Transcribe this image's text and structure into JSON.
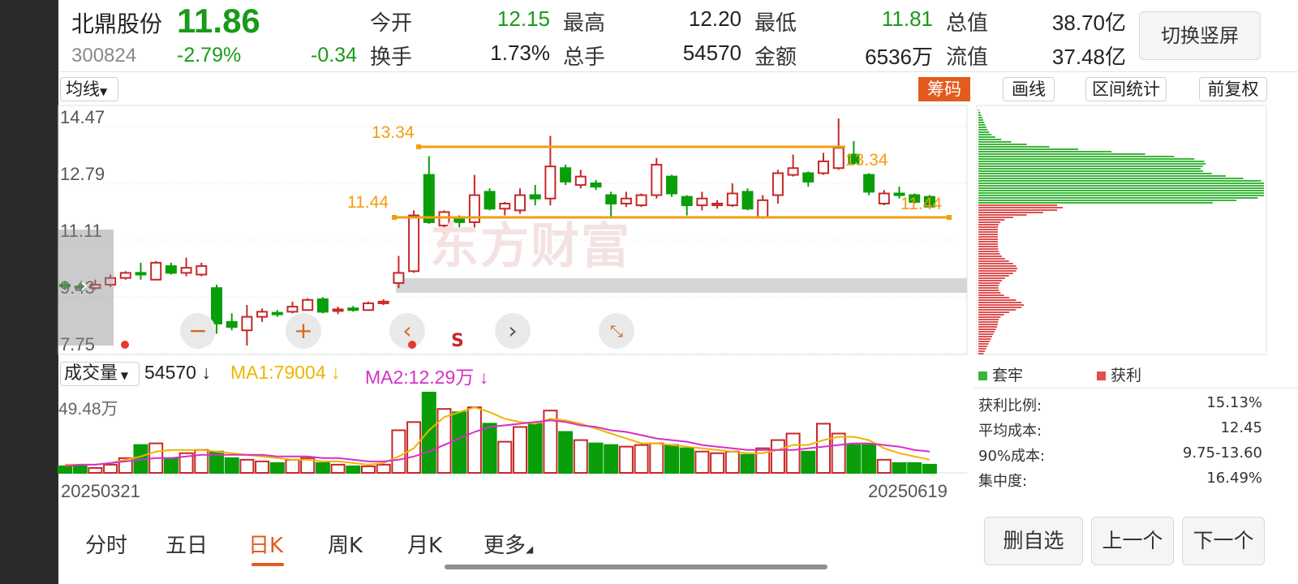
{
  "header": {
    "name": "北鼎股份",
    "price": "11.86",
    "code": "300824",
    "change_pct": "-2.79%",
    "change": "-0.34",
    "open_label": "今开",
    "open_value": "12.15",
    "high_label": "最高",
    "high_value": "12.20",
    "low_label": "最低",
    "low_value": "11.81",
    "mcap_label": "总值",
    "mcap_value": "38.70亿",
    "turnover_label": "换手",
    "turnover_value": "1.73%",
    "volume_label": "总手",
    "volume_value": "54570",
    "amount_label": "金额",
    "amount_value": "6536万",
    "float_label": "流值",
    "float_value": "37.48亿",
    "switch_button": "切换竖屏"
  },
  "toolbar": {
    "ma_select": "均线",
    "chips_button": "筹码",
    "draw_button": "画线",
    "range_stats_button": "区间统计",
    "adjust_button": "前复权"
  },
  "price_chart": {
    "y_ticks": [
      "14.47",
      "12.79",
      "11.11",
      "9.43",
      "7.75"
    ],
    "y_min": 7.75,
    "y_max": 14.47,
    "line_upper_label": "13.34",
    "line_upper_value": 13.34,
    "line_lower_label": "11.44",
    "line_lower_value": 11.44,
    "upper_right_label": "13.34",
    "lower_right_label": "11.44",
    "sell_marker": "S",
    "watermark": "东方财富",
    "colors": {
      "up": "#c62828",
      "down": "#0a9e0a",
      "line": "#f39c12"
    }
  },
  "candles": [
    {
      "o": 9.55,
      "c": 9.5,
      "h": 9.62,
      "l": 9.4
    },
    {
      "o": 9.5,
      "c": 9.45,
      "h": 9.58,
      "l": 9.36
    },
    {
      "o": 9.45,
      "c": 9.55,
      "h": 9.7,
      "l": 9.4
    },
    {
      "o": 9.55,
      "c": 9.75,
      "h": 9.85,
      "l": 9.48
    },
    {
      "o": 9.75,
      "c": 9.9,
      "h": 9.95,
      "l": 9.7
    },
    {
      "o": 9.9,
      "c": 9.85,
      "h": 10.2,
      "l": 9.7
    },
    {
      "o": 9.7,
      "c": 10.2,
      "h": 10.25,
      "l": 9.68
    },
    {
      "o": 10.1,
      "c": 9.9,
      "h": 10.2,
      "l": 9.85
    },
    {
      "o": 9.9,
      "c": 10.05,
      "h": 10.35,
      "l": 9.8
    },
    {
      "o": 9.85,
      "c": 10.1,
      "h": 10.2,
      "l": 9.8
    },
    {
      "o": 9.45,
      "c": 8.4,
      "h": 9.55,
      "l": 8.1
    },
    {
      "o": 8.45,
      "c": 8.3,
      "h": 8.7,
      "l": 8.2
    },
    {
      "o": 8.2,
      "c": 8.6,
      "h": 8.95,
      "l": 7.75
    },
    {
      "o": 8.6,
      "c": 8.75,
      "h": 8.85,
      "l": 8.45
    },
    {
      "o": 8.72,
      "c": 8.68,
      "h": 8.8,
      "l": 8.6
    },
    {
      "o": 8.75,
      "c": 8.9,
      "h": 9.05,
      "l": 8.7
    },
    {
      "o": 8.8,
      "c": 9.1,
      "h": 9.15,
      "l": 8.78
    },
    {
      "o": 9.12,
      "c": 8.75,
      "h": 9.18,
      "l": 8.7
    },
    {
      "o": 8.78,
      "c": 8.82,
      "h": 8.9,
      "l": 8.68
    },
    {
      "o": 8.85,
      "c": 8.8,
      "h": 8.92,
      "l": 8.75
    },
    {
      "o": 8.8,
      "c": 9.0,
      "h": 9.05,
      "l": 8.78
    },
    {
      "o": 9.0,
      "c": 9.05,
      "h": 9.12,
      "l": 8.95
    },
    {
      "o": 9.6,
      "c": 9.9,
      "h": 10.4,
      "l": 9.45
    },
    {
      "o": 9.95,
      "c": 11.6,
      "h": 11.75,
      "l": 9.9
    },
    {
      "o": 12.8,
      "c": 11.4,
      "h": 13.35,
      "l": 11.35
    },
    {
      "o": 11.3,
      "c": 11.7,
      "h": 11.75,
      "l": 11.05
    },
    {
      "o": 11.48,
      "c": 11.4,
      "h": 11.6,
      "l": 11.25
    },
    {
      "o": 11.4,
      "c": 12.2,
      "h": 12.8,
      "l": 11.2
    },
    {
      "o": 12.3,
      "c": 11.8,
      "h": 12.4,
      "l": 11.75
    },
    {
      "o": 11.8,
      "c": 11.95,
      "h": 12.0,
      "l": 11.6
    },
    {
      "o": 11.75,
      "c": 12.2,
      "h": 12.4,
      "l": 11.65
    },
    {
      "o": 12.2,
      "c": 12.1,
      "h": 12.5,
      "l": 11.9
    },
    {
      "o": 12.1,
      "c": 13.05,
      "h": 13.95,
      "l": 11.9
    },
    {
      "o": 13.0,
      "c": 12.6,
      "h": 13.1,
      "l": 12.5
    },
    {
      "o": 12.5,
      "c": 12.75,
      "h": 12.95,
      "l": 12.4
    },
    {
      "o": 12.55,
      "c": 12.45,
      "h": 12.65,
      "l": 12.35
    },
    {
      "o": 12.2,
      "c": 11.95,
      "h": 12.3,
      "l": 11.55
    },
    {
      "o": 11.95,
      "c": 12.1,
      "h": 12.3,
      "l": 11.85
    },
    {
      "o": 11.9,
      "c": 12.2,
      "h": 12.25,
      "l": 11.85
    },
    {
      "o": 12.2,
      "c": 13.1,
      "h": 13.3,
      "l": 12.1
    },
    {
      "o": 12.75,
      "c": 12.25,
      "h": 12.8,
      "l": 12.15
    },
    {
      "o": 12.15,
      "c": 11.9,
      "h": 12.2,
      "l": 11.6
    },
    {
      "o": 11.9,
      "c": 12.1,
      "h": 12.3,
      "l": 11.75
    },
    {
      "o": 11.9,
      "c": 11.95,
      "h": 12.05,
      "l": 11.8
    },
    {
      "o": 11.9,
      "c": 12.25,
      "h": 12.55,
      "l": 11.85
    },
    {
      "o": 12.3,
      "c": 11.8,
      "h": 12.4,
      "l": 11.75
    },
    {
      "o": 11.55,
      "c": 12.05,
      "h": 12.2,
      "l": 11.5
    },
    {
      "o": 12.2,
      "c": 12.85,
      "h": 12.95,
      "l": 11.95
    },
    {
      "o": 12.8,
      "c": 13.0,
      "h": 13.4,
      "l": 12.75
    },
    {
      "o": 12.85,
      "c": 12.6,
      "h": 12.9,
      "l": 12.45
    },
    {
      "o": 12.85,
      "c": 13.2,
      "h": 13.45,
      "l": 12.8
    },
    {
      "o": 13.0,
      "c": 13.6,
      "h": 14.47,
      "l": 12.95
    },
    {
      "o": 13.4,
      "c": 13.15,
      "h": 13.8,
      "l": 13.1
    },
    {
      "o": 12.8,
      "c": 12.3,
      "h": 12.85,
      "l": 12.2
    },
    {
      "o": 11.95,
      "c": 12.25,
      "h": 12.35,
      "l": 11.9
    },
    {
      "o": 12.25,
      "c": 12.2,
      "h": 12.45,
      "l": 12.1
    },
    {
      "o": 12.2,
      "c": 12.0,
      "h": 12.25,
      "l": 11.95
    },
    {
      "o": 12.15,
      "c": 11.86,
      "h": 12.2,
      "l": 11.81
    }
  ],
  "volume_section": {
    "selector": "成交量",
    "volume_value": "54570",
    "ma1_label": "MA1:79004",
    "ma2_label": "MA2:12.29万",
    "max_label": "49.48万",
    "max_value": 49.48,
    "date_start": "20250321",
    "date_end": "20250619",
    "volumes": [
      4,
      4,
      3,
      5,
      9,
      17,
      18,
      9,
      12,
      14,
      13,
      9,
      8,
      7,
      6,
      8,
      9,
      6,
      5,
      4,
      4,
      5,
      26,
      31,
      49,
      39,
      37,
      40,
      30,
      19,
      28,
      30,
      38,
      25,
      20,
      18,
      17,
      16,
      17,
      18,
      17,
      15,
      13,
      12,
      13,
      11,
      15,
      20,
      24,
      13,
      30,
      24,
      17,
      17,
      8,
      6,
      6,
      5
    ],
    "ma1": [
      5,
      5,
      5,
      6,
      8,
      10,
      13,
      14,
      14,
      14,
      13,
      12,
      11,
      10,
      9,
      8,
      8,
      7,
      7,
      6,
      5,
      6,
      10,
      15,
      26,
      34,
      37,
      40,
      37,
      33,
      31,
      30,
      33,
      32,
      30,
      27,
      24,
      21,
      18,
      18,
      17,
      16,
      15,
      14,
      13,
      12,
      12,
      14,
      17,
      17,
      20,
      22,
      22,
      20,
      15,
      12,
      10,
      8
    ],
    "ma2": [
      4,
      5,
      5,
      6,
      7,
      8,
      9,
      9,
      10,
      11,
      11,
      11,
      11,
      11,
      10,
      10,
      10,
      9,
      9,
      8,
      7,
      7,
      8,
      10,
      13,
      17,
      21,
      25,
      28,
      29,
      30,
      31,
      32,
      31,
      29,
      28,
      26,
      25,
      23,
      21,
      20,
      19,
      17,
      16,
      15,
      14,
      14,
      14,
      14,
      15,
      16,
      17,
      18,
      18,
      17,
      16,
      14,
      13
    ],
    "colors": {
      "ma1": "#f0b400",
      "ma2": "#d630c8"
    }
  },
  "chip_panel": {
    "legend_trapped": "套牢",
    "legend_profit": "获利",
    "stats": [
      {
        "label": "获利比例:",
        "value": "15.13%"
      },
      {
        "label": "平均成本:",
        "value": "12.45"
      },
      {
        "label": "90%成本:",
        "value": "9.75-13.60"
      },
      {
        "label": "集中度:",
        "value": "16.49%"
      }
    ],
    "colors": {
      "trapped": "#3cb53c",
      "profit": "#e05050"
    }
  },
  "tabs": [
    {
      "label": "分时"
    },
    {
      "label": "五日"
    },
    {
      "label": "日K"
    },
    {
      "label": "周K"
    },
    {
      "label": "月K"
    },
    {
      "label": "更多"
    }
  ],
  "footer_buttons": {
    "delete": "删自选",
    "prev": "上一个",
    "next": "下一个"
  }
}
